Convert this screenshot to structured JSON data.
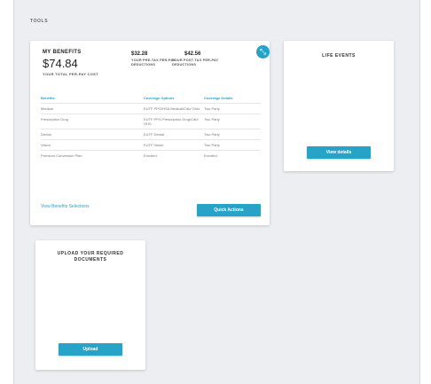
{
  "section": {
    "label": "TOOLS"
  },
  "benefits": {
    "title": "MY BENEFITS",
    "total_amount": "$74.84",
    "total_label": "YOUR TOTAL PER-PAY COST",
    "pretax_amount": "$32.28",
    "pretax_label": "YOUR PRE-TAX PER-PAY DEDUCTIONS",
    "posttax_amount": "$42.56",
    "posttax_label": "YOUR POST-TAX PER-PAY DEDUCTIONS",
    "fab_icon": "expand-icon",
    "columns": [
      "Benefits",
      "Coverage Options",
      "Coverage Details"
    ],
    "rows": [
      [
        "Medical",
        "EUTF PPO/HSA Medical/Cdb/ Ohio",
        "Two Party"
      ],
      [
        "Prescription Drug",
        "EUTF PPO Prescription Drug/Cdb/ OHS",
        "Two Party"
      ],
      [
        "Dental",
        "EUTF Dental",
        "Two Party"
      ],
      [
        "Vision",
        "EUTF Vision",
        "Two Party"
      ],
      [
        "Premium Conversion Plan",
        "Enrolled",
        "Enrolled"
      ]
    ],
    "view_link": "View Benefits Selections",
    "quick_actions": "Quick Actions"
  },
  "life_events": {
    "title": "LIFE EVENTS",
    "button": "View details"
  },
  "upload": {
    "title": "UPLOAD YOUR REQUIRED DOCUMENTS",
    "button": "Upload"
  },
  "colors": {
    "accent": "#27a3c8",
    "background": "#eceef1"
  }
}
